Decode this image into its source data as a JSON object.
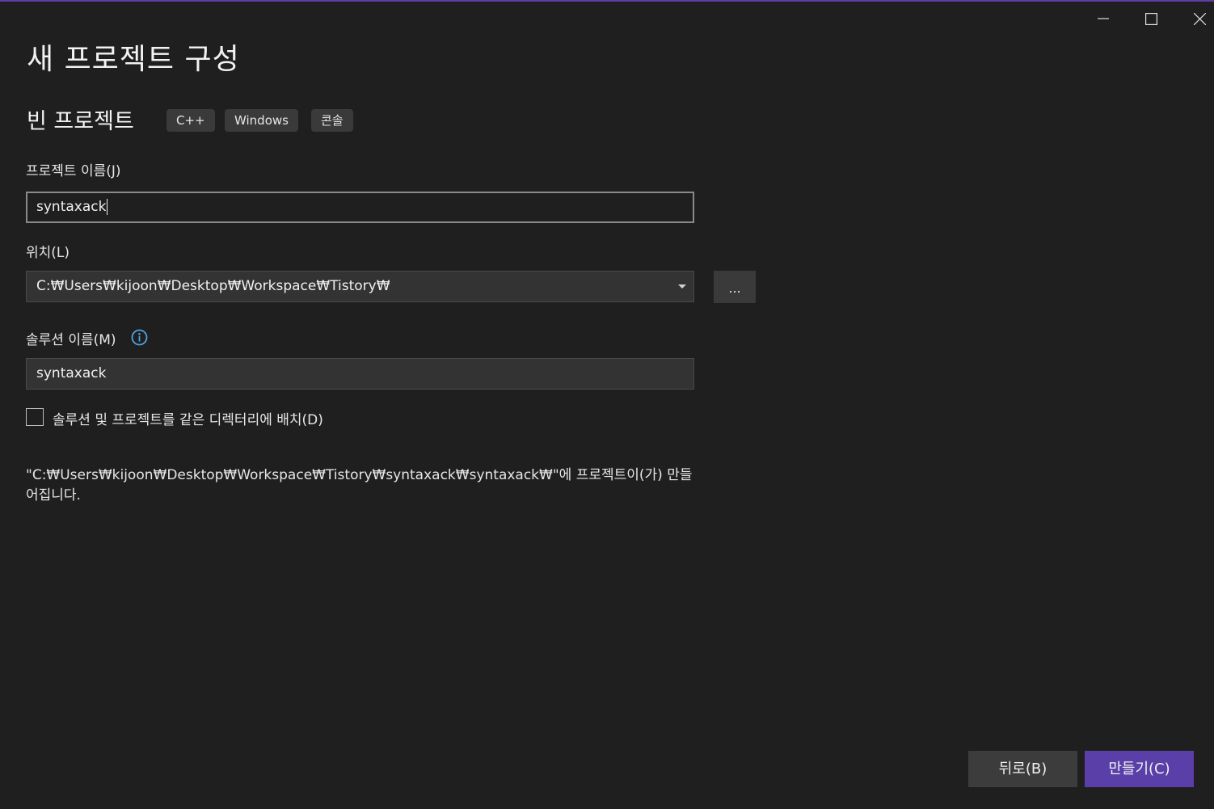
{
  "window": {
    "accent_color": "#5b3fa8",
    "controls": [
      "minimize-icon",
      "maximize-icon",
      "close-icon"
    ]
  },
  "header": {
    "title": "새 프로젝트 구성"
  },
  "template": {
    "name": "빈 프로젝트",
    "tags": [
      "C++",
      "Windows",
      "콘솔"
    ]
  },
  "form": {
    "project_name_label": "프로젝트 이름(J)",
    "project_name_value": "syntaxack",
    "location_label": "위치(L)",
    "location_value": "C:₩Users₩kijoon₩Desktop₩Workspace₩Tistory₩",
    "browse_label": "...",
    "solution_name_label": "솔루션 이름(M)",
    "solution_name_value": "syntaxack",
    "same_dir_checkbox_label": "솔루션 및 프로젝트를 같은 디렉터리에 배치(D)",
    "same_dir_checked": false,
    "path_note": "\"C:₩Users₩kijoon₩Desktop₩Workspace₩Tistory₩syntaxack₩syntaxack₩\"에 프로젝트이(가) 만들어집니다."
  },
  "footer": {
    "back_label": "뒤로(B)",
    "create_label": "만들기(C)",
    "create_color": "#5b3fa8"
  }
}
